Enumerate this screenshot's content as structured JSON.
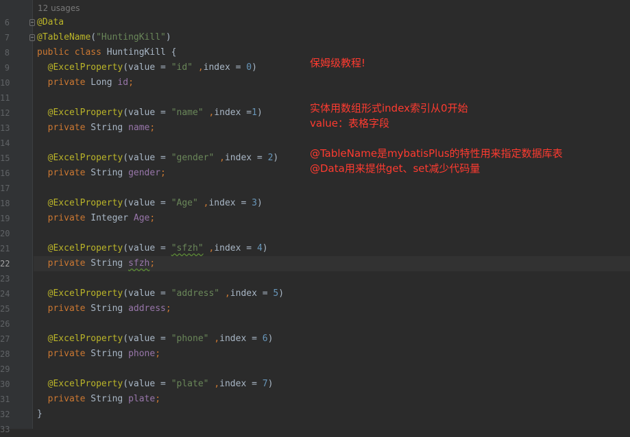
{
  "editor": {
    "usages_hint": "12 usages",
    "line_numbers": [
      "6",
      "7",
      "8",
      "9",
      "10",
      "11",
      "12",
      "13",
      "14",
      "15",
      "16",
      "17",
      "18",
      "19",
      "20",
      "21",
      "22",
      "23",
      "24",
      "25",
      "26",
      "27",
      "28",
      "29",
      "30",
      "31",
      "32",
      "33"
    ],
    "current_line": "22"
  },
  "code": {
    "annotation_data": "@Data",
    "table_annotation": "@TableName",
    "table_open": "(",
    "table_value": "\"HuntingKill\"",
    "table_close": ")",
    "class_kw": "public class",
    "class_name": " HuntingKill {",
    "property_annotation": "@ExcelProperty",
    "value_prefix": "(value = ",
    "index_prefix": "index = ",
    "private_kw": "private",
    "comma": ",",
    "semicolon": ";",
    "close_paren": ")",
    "closing_brace": "}",
    "fields": [
      {
        "value_str": "\"id\"",
        "index_label": "index = ",
        "index": "0",
        "type": "Long",
        "name": "id"
      },
      {
        "value_str": "\"name\"",
        "index_label": "index =",
        "index": "1",
        "type": "String",
        "name": "name"
      },
      {
        "value_str": "\"gender\"",
        "index_label": "index = ",
        "index": "2",
        "type": "String",
        "name": "gender"
      },
      {
        "value_str": "\"Age\"",
        "index_label": "index = ",
        "index": "3",
        "type": "Integer",
        "name": "Age"
      },
      {
        "value_str": "\"sfzh\"",
        "index_label": "index = ",
        "index": "4",
        "type": "String",
        "name": "sfzh"
      },
      {
        "value_str": "\"address\"",
        "index_label": "index = ",
        "index": "5",
        "type": "String",
        "name": "address"
      },
      {
        "value_str": "\"phone\"",
        "index_label": "index = ",
        "index": "6",
        "type": "String",
        "name": "phone"
      },
      {
        "value_str": "\"plate\"",
        "index_label": "index = ",
        "index": "7",
        "type": "String",
        "name": "plate"
      }
    ]
  },
  "notes": {
    "n1": "保姆级教程!",
    "n2": "实体用数组形式index索引从0开始",
    "n3": "value：表格字段",
    "n4": "@TableName是mybatisPlus的特性用来指定数据库表",
    "n5": "@Data用来提供get、set减少代码量"
  },
  "colors": {
    "background": "#2b2b2b",
    "keyword": "#cc7832",
    "annotation": "#bbb529",
    "string": "#6a8759",
    "number": "#6897bb",
    "field": "#9876aa",
    "note": "#ff3b30"
  }
}
